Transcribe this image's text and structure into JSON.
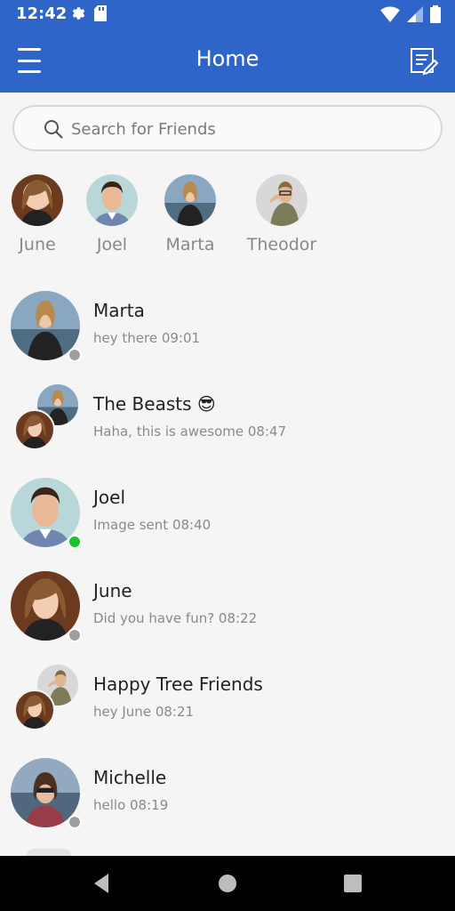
{
  "status_bar": {
    "time": "12:42"
  },
  "app_bar": {
    "title": "Home"
  },
  "search": {
    "placeholder": "Search for Friends",
    "value": ""
  },
  "stories": [
    {
      "label": "June"
    },
    {
      "label": "Joel"
    },
    {
      "label": "Marta"
    },
    {
      "label": "Theodor"
    }
  ],
  "chats": [
    {
      "name": "Marta",
      "preview": "hey there 09:01",
      "status": "offline"
    },
    {
      "name": "The Beasts 😎",
      "preview": "Haha, this is awesome 08:47",
      "status": "group"
    },
    {
      "name": "Joel",
      "preview": "Image sent 08:40",
      "status": "online"
    },
    {
      "name": "June",
      "preview": "Did you have fun? 08:22",
      "status": "offline"
    },
    {
      "name": "Happy Tree Friends",
      "preview": "hey June 08:21",
      "status": "group"
    },
    {
      "name": "Michelle",
      "preview": "hello 08:19",
      "status": "offline"
    }
  ],
  "colors": {
    "primary": "#2f64c8",
    "online": "#19c32a",
    "offline": "#9e9e9e"
  }
}
